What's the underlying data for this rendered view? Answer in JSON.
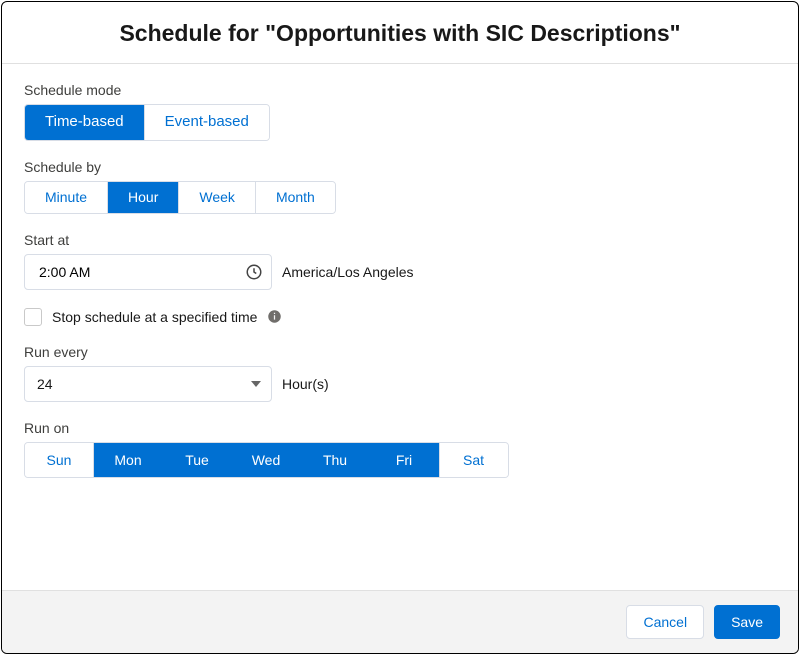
{
  "header": {
    "title": "Schedule for \"Opportunities with SIC Descriptions\""
  },
  "mode": {
    "label": "Schedule mode",
    "options": {
      "time": "Time-based",
      "event": "Event-based"
    }
  },
  "schedule_by": {
    "label": "Schedule by",
    "options": {
      "minute": "Minute",
      "hour": "Hour",
      "week": "Week",
      "month": "Month"
    }
  },
  "start_at": {
    "label": "Start at",
    "value": "2:00 AM",
    "timezone": "America/Los Angeles"
  },
  "stop": {
    "label": "Stop schedule at a specified time"
  },
  "run_every": {
    "label": "Run every",
    "value": "24",
    "unit": "Hour(s)"
  },
  "run_on": {
    "label": "Run on",
    "days": {
      "sun": "Sun",
      "mon": "Mon",
      "tue": "Tue",
      "wed": "Wed",
      "thu": "Thu",
      "fri": "Fri",
      "sat": "Sat"
    }
  },
  "footer": {
    "cancel": "Cancel",
    "save": "Save"
  }
}
